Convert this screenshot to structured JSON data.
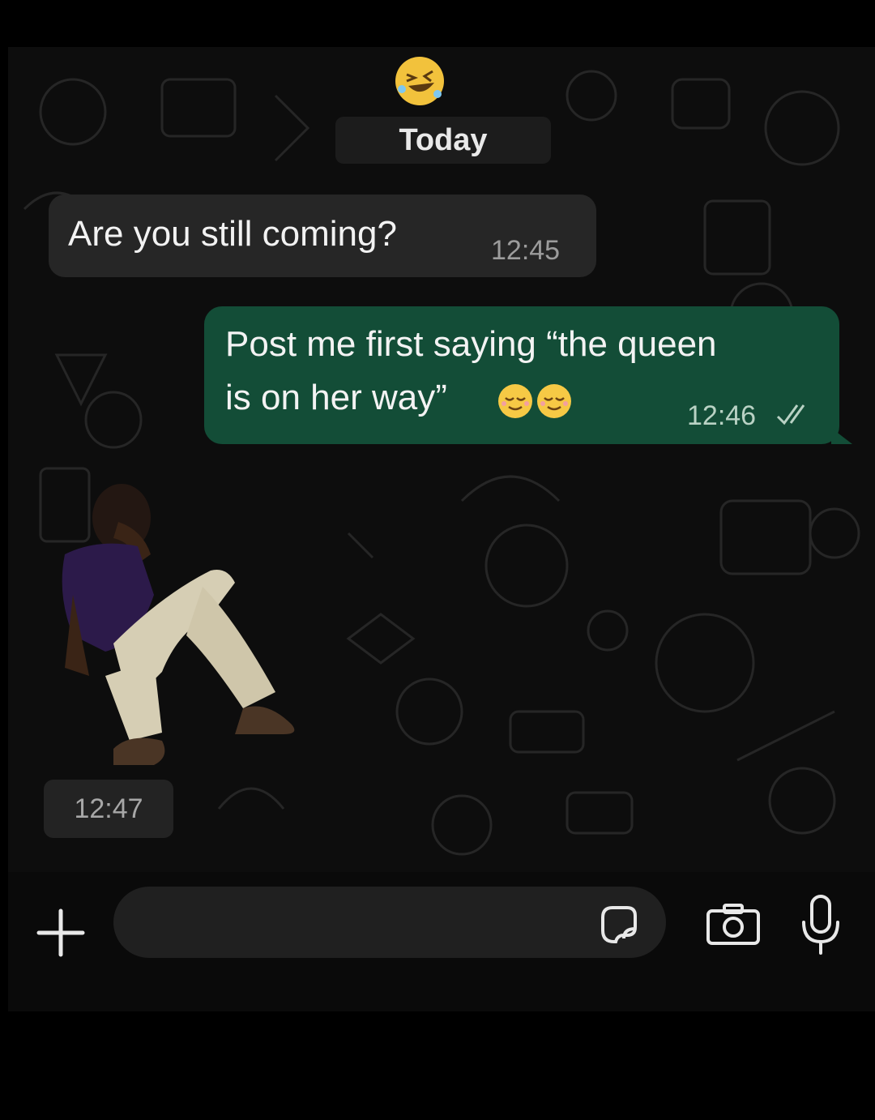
{
  "chat": {
    "date_separator": "Today",
    "messages": [
      {
        "direction": "incoming",
        "text": "Are you still coming?",
        "time": "12:45"
      },
      {
        "direction": "outgoing",
        "line1": "Post me first saying “the queen",
        "line2": "is on her way”",
        "emoji": "relieved-face-emoji x2",
        "time": "12:46",
        "status": "read"
      },
      {
        "direction": "incoming",
        "type": "sticker",
        "sticker": "man-sitting-facepalm-sticker",
        "time": "12:47"
      }
    ],
    "reaction_emoji": "rolling-on-floor-laughing-emoji"
  },
  "composer": {
    "placeholder": "",
    "icons": [
      "plus-icon",
      "sticker-icon",
      "camera-icon",
      "microphone-icon"
    ]
  },
  "colors": {
    "background": "#0d0d0d",
    "incoming_bubble": "#262626",
    "outgoing_bubble": "#134d37",
    "read_ticks": "#b9d2c4"
  }
}
